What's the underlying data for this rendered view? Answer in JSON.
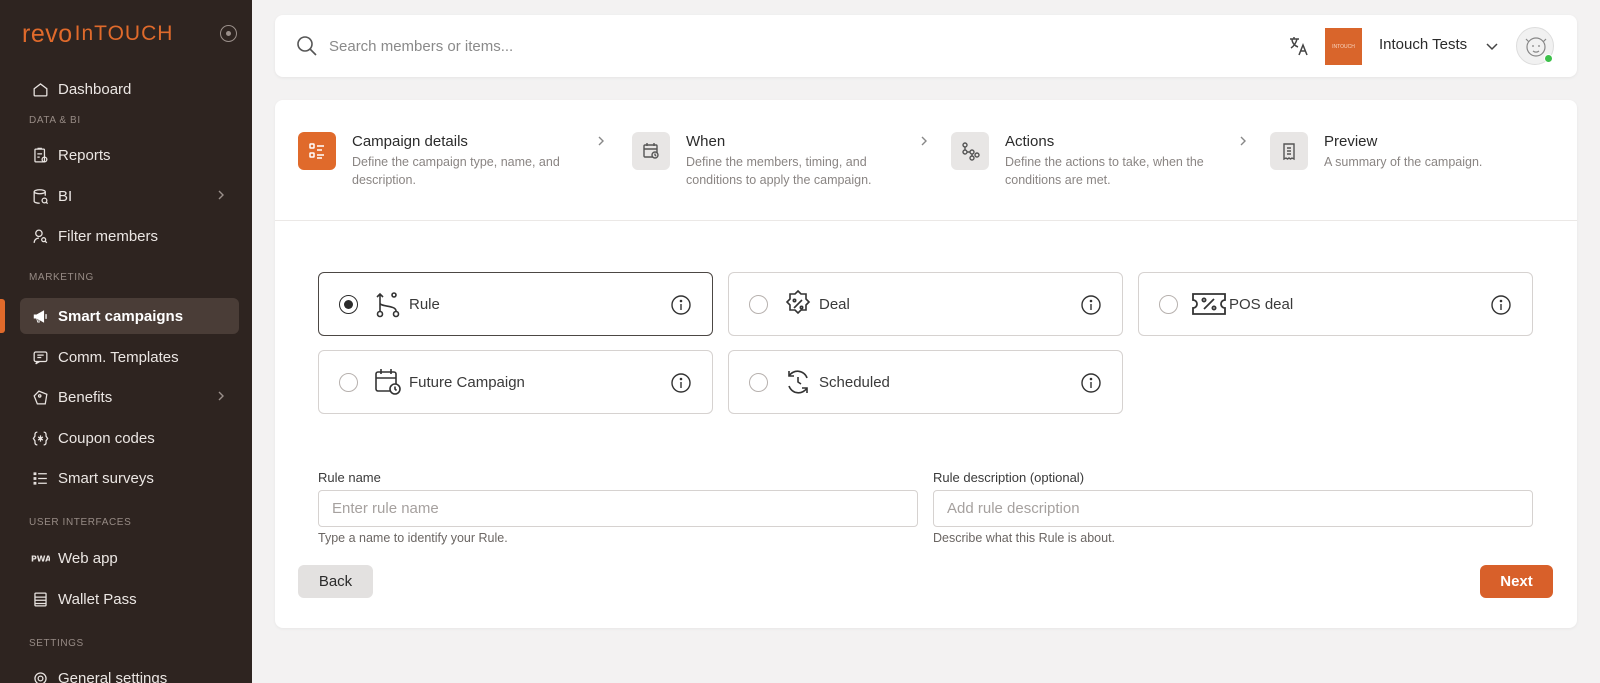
{
  "sidebar": {
    "brand": {
      "revo": "revo",
      "intouch": "InTOUCH"
    },
    "sections": {
      "data_bi": "DATA & BI",
      "marketing": "MARKETING",
      "user_interfaces": "USER INTERFACES",
      "settings": "SETTINGS"
    },
    "items": {
      "dashboard": "Dashboard",
      "reports": "Reports",
      "bi": "BI",
      "filter_members": "Filter members",
      "smart_campaigns": "Smart campaigns",
      "comm_templates": "Comm. Templates",
      "benefits": "Benefits",
      "coupon_codes": "Coupon codes",
      "smart_surveys": "Smart surveys",
      "web_app": "Web app",
      "wallet_pass": "Wallet Pass",
      "general_settings": "General settings"
    },
    "active_item": "Smart campaigns"
  },
  "topbar": {
    "search_placeholder": "Search members or items...",
    "org_logo_text": "INTOUCH",
    "org_name": "Intouch Tests"
  },
  "stepper": [
    {
      "title": "Campaign details",
      "description": "Define the campaign type, name, and description.",
      "icon": "list-icon",
      "active": true
    },
    {
      "title": "When",
      "description": "Define the members, timing, and conditions to apply the campaign.",
      "icon": "calendar-clock-icon",
      "active": false
    },
    {
      "title": "Actions",
      "description": "Define the actions to take, when the conditions are met.",
      "icon": "flow-icon",
      "active": false
    },
    {
      "title": "Preview",
      "description": "A summary of the campaign.",
      "icon": "receipt-icon",
      "active": false
    }
  ],
  "campaign_types": [
    {
      "label": "Rule",
      "icon": "branch-icon",
      "selected": true
    },
    {
      "label": "Deal",
      "icon": "discount-badge-icon",
      "selected": false
    },
    {
      "label": "POS deal",
      "icon": "coupon-ticket-icon",
      "selected": false
    },
    {
      "label": "Future Campaign",
      "icon": "calendar-clock-icon",
      "selected": false
    },
    {
      "label": "Scheduled",
      "icon": "refresh-clock-icon",
      "selected": false
    }
  ],
  "form": {
    "rule_name": {
      "label": "Rule name",
      "placeholder": "Enter rule name",
      "value": "",
      "helper": "Type a name to identify your Rule."
    },
    "rule_description": {
      "label": "Rule description (optional)",
      "placeholder": "Add rule description",
      "value": "",
      "helper": "Describe what this Rule is about."
    }
  },
  "buttons": {
    "back": "Back",
    "next": "Next"
  },
  "colors": {
    "accent": "#e06a2b",
    "sidebar_bg": "#2e2420",
    "online": "#3cc04a"
  }
}
